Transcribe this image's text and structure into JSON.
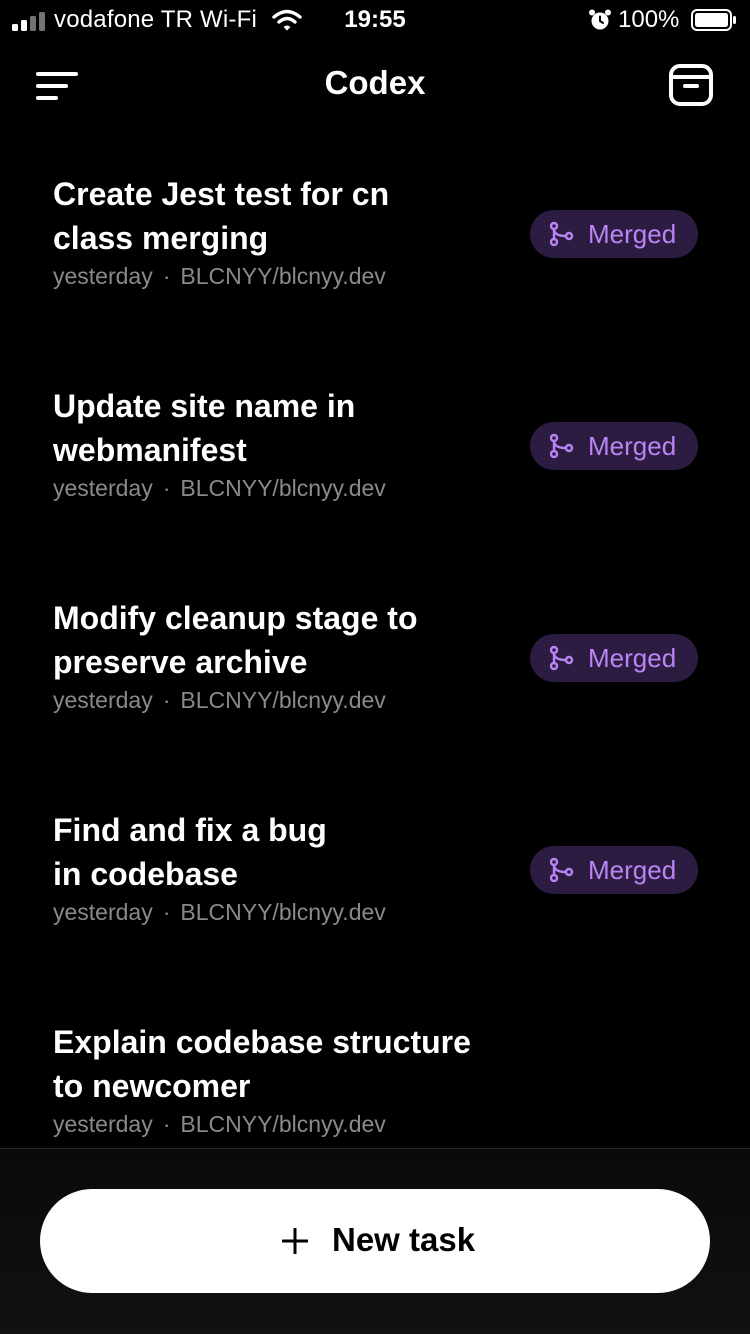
{
  "status_bar": {
    "carrier": "vodafone TR Wi-Fi",
    "time": "19:55",
    "battery": "100%",
    "icons": [
      "signal-icon",
      "wifi-icon",
      "alarm-icon",
      "battery-icon"
    ]
  },
  "header": {
    "title": "Codex",
    "left_icon": "menu-icon",
    "right_icon": "archive-icon"
  },
  "tasks": [
    {
      "title": "Create Jest test for cn\nclass merging",
      "time": "yesterday",
      "separator": "·",
      "repo": "BLCNYY/blcnyy.dev",
      "status": "Merged"
    },
    {
      "title": "Update site name in\nwebmanifest",
      "time": "yesterday",
      "separator": "·",
      "repo": "BLCNYY/blcnyy.dev",
      "status": "Merged"
    },
    {
      "title": "Modify cleanup stage to\npreserve archive",
      "time": "yesterday",
      "separator": "·",
      "repo": "BLCNYY/blcnyy.dev",
      "status": "Merged"
    },
    {
      "title": "Find and fix a bug\nin codebase",
      "time": "yesterday",
      "separator": "·",
      "repo": "BLCNYY/blcnyy.dev",
      "status": "Merged"
    },
    {
      "title": "Explain codebase structure\nto newcomer",
      "time": "yesterday",
      "separator": "·",
      "repo": "BLCNYY/blcnyy.dev"
    }
  ],
  "footer": {
    "new_task_label": "New task",
    "new_task_icon": "plus-icon"
  },
  "colors": {
    "background": "#000000",
    "badge_background": "#2c1c42",
    "badge_text": "#b985f4",
    "meta_text": "#8a8a8a",
    "button_background": "#ffffff"
  }
}
